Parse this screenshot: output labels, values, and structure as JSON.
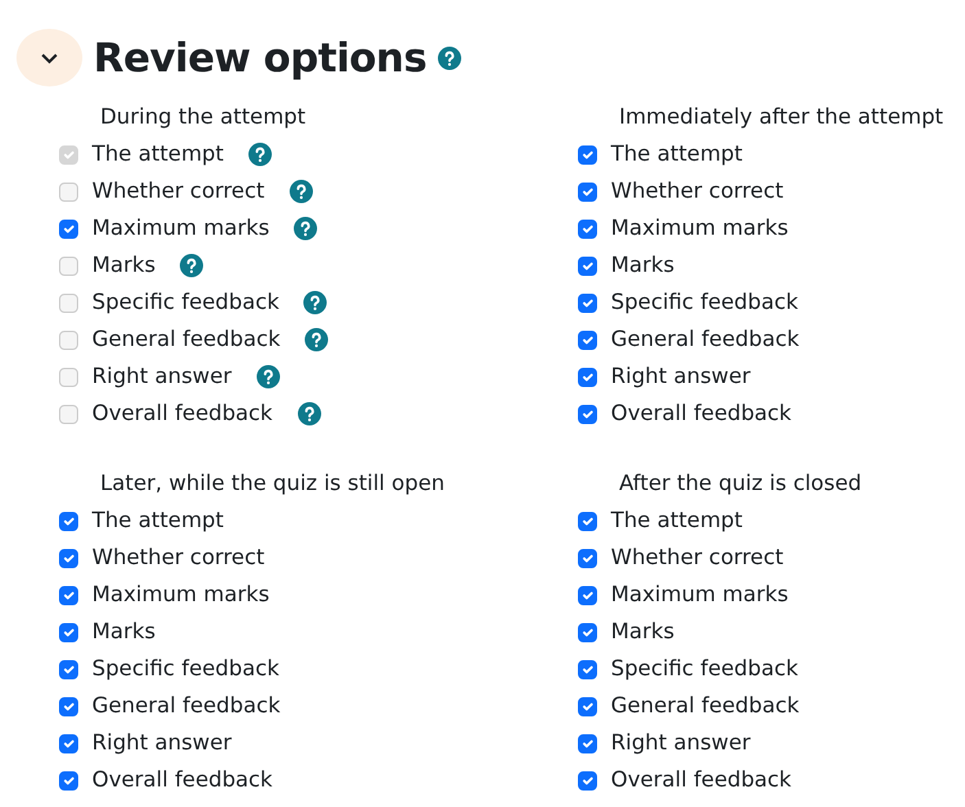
{
  "section": {
    "title": "Review options",
    "expanded": true,
    "help": true
  },
  "groups": [
    {
      "heading": "During the attempt",
      "options": [
        {
          "label": "The attempt",
          "checked": true,
          "disabled": true,
          "help": true
        },
        {
          "label": "Whether correct",
          "checked": false,
          "disabled": false,
          "help": true
        },
        {
          "label": "Maximum marks",
          "checked": true,
          "disabled": false,
          "help": true
        },
        {
          "label": "Marks",
          "checked": false,
          "disabled": false,
          "help": true
        },
        {
          "label": "Specific feedback",
          "checked": false,
          "disabled": false,
          "help": true
        },
        {
          "label": "General feedback",
          "checked": false,
          "disabled": false,
          "help": true
        },
        {
          "label": "Right answer",
          "checked": false,
          "disabled": false,
          "help": true
        },
        {
          "label": "Overall feedback",
          "checked": false,
          "disabled": false,
          "help": true
        }
      ]
    },
    {
      "heading": "Immediately after the attempt",
      "options": [
        {
          "label": "The attempt",
          "checked": true,
          "disabled": false,
          "help": false
        },
        {
          "label": "Whether correct",
          "checked": true,
          "disabled": false,
          "help": false
        },
        {
          "label": "Maximum marks",
          "checked": true,
          "disabled": false,
          "help": false
        },
        {
          "label": "Marks",
          "checked": true,
          "disabled": false,
          "help": false
        },
        {
          "label": "Specific feedback",
          "checked": true,
          "disabled": false,
          "help": false
        },
        {
          "label": "General feedback",
          "checked": true,
          "disabled": false,
          "help": false
        },
        {
          "label": "Right answer",
          "checked": true,
          "disabled": false,
          "help": false
        },
        {
          "label": "Overall feedback",
          "checked": true,
          "disabled": false,
          "help": false
        }
      ]
    },
    {
      "heading": "Later, while the quiz is still open",
      "options": [
        {
          "label": "The attempt",
          "checked": true,
          "disabled": false,
          "help": false
        },
        {
          "label": "Whether correct",
          "checked": true,
          "disabled": false,
          "help": false
        },
        {
          "label": "Maximum marks",
          "checked": true,
          "disabled": false,
          "help": false
        },
        {
          "label": "Marks",
          "checked": true,
          "disabled": false,
          "help": false
        },
        {
          "label": "Specific feedback",
          "checked": true,
          "disabled": false,
          "help": false
        },
        {
          "label": "General feedback",
          "checked": true,
          "disabled": false,
          "help": false
        },
        {
          "label": "Right answer",
          "checked": true,
          "disabled": false,
          "help": false
        },
        {
          "label": "Overall feedback",
          "checked": true,
          "disabled": false,
          "help": false
        }
      ]
    },
    {
      "heading": "After the quiz is closed",
      "options": [
        {
          "label": "The attempt",
          "checked": true,
          "disabled": false,
          "help": false
        },
        {
          "label": "Whether correct",
          "checked": true,
          "disabled": false,
          "help": false
        },
        {
          "label": "Maximum marks",
          "checked": true,
          "disabled": false,
          "help": false
        },
        {
          "label": "Marks",
          "checked": true,
          "disabled": false,
          "help": false
        },
        {
          "label": "Specific feedback",
          "checked": true,
          "disabled": false,
          "help": false
        },
        {
          "label": "General feedback",
          "checked": true,
          "disabled": false,
          "help": false
        },
        {
          "label": "Right answer",
          "checked": true,
          "disabled": false,
          "help": false
        },
        {
          "label": "Overall feedback",
          "checked": true,
          "disabled": false,
          "help": false
        }
      ]
    }
  ]
}
